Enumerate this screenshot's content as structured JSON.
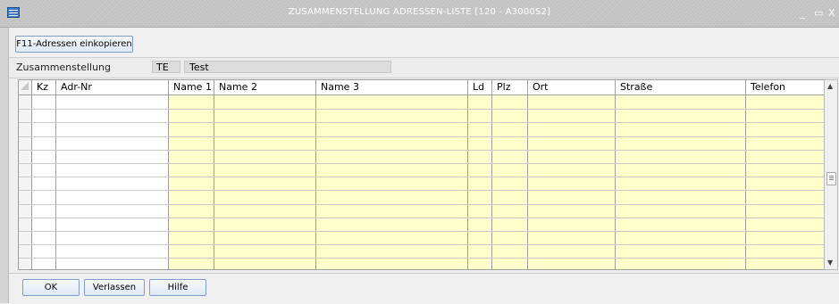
{
  "window": {
    "title": "ZUSAMMENSTELLUNG ADRESSEN-LISTE  [120 - A3000S2]",
    "icon": "list-window-icon",
    "controls": {
      "minimize": "_",
      "maximize": "▭",
      "close": "X"
    }
  },
  "toolbar": {
    "f11_label": "F11-Adressen einkopieren"
  },
  "info": {
    "label": "Zusammenstellung",
    "code": "TE",
    "name": "Test"
  },
  "grid": {
    "columns": [
      "Kz",
      "Adr-Nr",
      "Name 1",
      "Name 2",
      "Name 3",
      "Ld",
      "Plz",
      "Ort",
      "Straße",
      "Telefon"
    ],
    "row_count": 12,
    "rows": [],
    "editable_color": "#ffffcc"
  },
  "scrollbar": {
    "up": "▲",
    "down": "▼"
  },
  "footer": {
    "ok_label": "OK",
    "verlassen_label": "Verlassen",
    "hilfe_label": "Hilfe"
  }
}
